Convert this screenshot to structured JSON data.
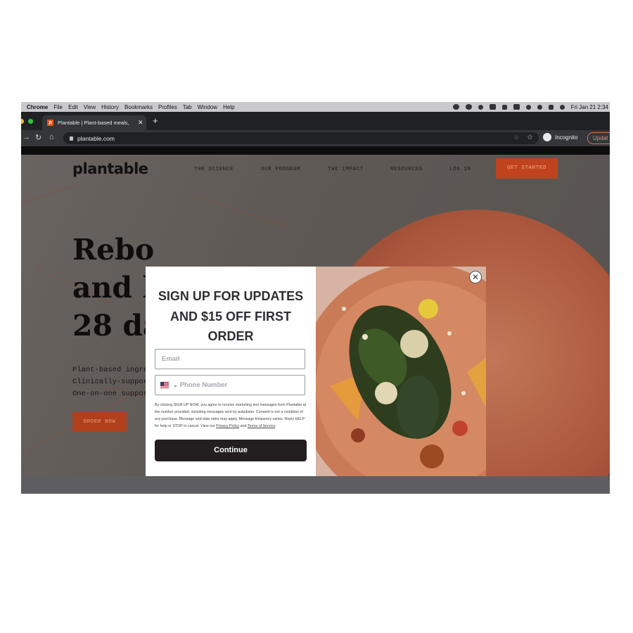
{
  "menubar": {
    "app": "Chrome",
    "items": [
      "File",
      "Edit",
      "View",
      "History",
      "Bookmarks",
      "Profiles",
      "Tab",
      "Window",
      "Help"
    ],
    "clock": "Fri Jan 21  2:34"
  },
  "browser": {
    "tab_title": "Plantable | Plant-based meals, ",
    "url": "plantable.com",
    "incognito_label": "Incognito",
    "update_label": "Updat"
  },
  "site": {
    "logo": "plantable",
    "nav": [
      "THE SCIENCE",
      "OUR PROGRAM",
      "THE IMPACT",
      "RESOURCES",
      "LOG IN"
    ],
    "cta": "GET STARTED",
    "hero_lines": [
      "Rebo",
      "and h",
      "28 da"
    ],
    "bullets": [
      "Plant-based ingredi",
      "Clinically-supportec",
      "One-on-one suppor"
    ],
    "order_now": "ORDER NOW"
  },
  "modal": {
    "title_lines": [
      "SIGN UP FOR UPDATES",
      "AND $15 OFF FIRST",
      "ORDER"
    ],
    "email_placeholder": "Email",
    "phone_placeholder": "Phone Number",
    "legal_text": "By clicking SIGN UP NOW, you agree to receive marketing text messages from Plantable at the number provided, including messages sent by autodialer. Consent is not a condition of any purchase. Message and data rates may apply. Message frequency varies. Reply HELP for help or STOP to cancel. View our",
    "privacy_link": "Privacy Policy",
    "and_word": "and",
    "terms_link": "Terms of Service",
    "button": "Continue"
  },
  "colors": {
    "accent": "#c0431d",
    "button_dark": "#231f20",
    "chrome_dark": "#202124",
    "menubar_bg": "#c9c9cc"
  }
}
